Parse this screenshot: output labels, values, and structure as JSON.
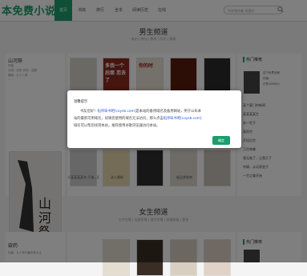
{
  "site": {
    "logo": "本免费小说"
  },
  "nav": {
    "items": [
      "首页",
      "书库",
      "排行",
      "全本",
      "阅读历史",
      "在线"
    ]
  },
  "search": {
    "placeholder": "书名和作者 关键字"
  },
  "male_section": {
    "title": "男生频道",
    "subtitle": "玄幻 | 修仙 | 都市 | 历史 | 悬疑"
  },
  "female_section": {
    "title": "女生频道",
    "subtitle": "古代言情 | 仙侠奇缘 | 现代言情 | 浪漫青春 | 更多"
  },
  "featured": {
    "name": "山河祭",
    "lines": [
      "作者",
      "分类：历史  状态：连载",
      "最新：九十八章"
    ],
    "desc": "……"
  },
  "books_top": [
    {
      "cover_title": "",
      "color": "#d7d2c8"
    },
    {
      "cover_title": "多我一个 后面 恋去了",
      "color": "#8a2a1e"
    },
    {
      "cover_title": "你的时",
      "color": "#e9e2d6"
    },
    {
      "cover_title": "",
      "color": "#5a1c0d"
    },
    {
      "cover_title": "",
      "color": "#2a2a2a"
    }
  ],
  "books_bottom": [
    {
      "caption": "上最顶级的宫殿法力无边",
      "color": "#cfcfcf"
    },
    {
      "caption": "逆天",
      "color": "#ead8b0"
    },
    {
      "caption": "",
      "color": "#2e2e2e"
    },
    {
      "caption": "",
      "color": "#dcd6cc"
    },
    {
      "caption": "",
      "color": "#c8c3b8"
    }
  ],
  "book_captions_bottom": [
    "十某某某某年 千道，旧有生...",
    "送人最新",
    "",
    "极品禁欲帝",
    ""
  ],
  "right_panel": {
    "title": "热门推荐",
    "info": [
      "这个世界全家",
      "作者：",
      "已有10000人"
    ],
    "items": [
      "某个豪门的新闻",
      "某某某某生",
      "末一世子",
      "真男世",
      "开挂后世",
      "万世帝尊",
      "我无敌了，让我天下",
      "夺嫡，从培养皇子",
      "一世之尊开始"
    ]
  },
  "female_right": {
    "title": "热门推荐"
  },
  "female_featured": {
    "name": "欲药",
    "line": "作者：九十年代都市夏大王"
  },
  "modal": {
    "title": "温馨提示",
    "line1_a": "书友您好！",
    "line1_link": "稻序味书吧[coysb.com]",
    "line1_b": "是本站的备用域名及备用网站，用于公布本",
    "line2": "站的最新可用域名，如果您使用的域名无法访问，那么点击",
    "line2_link": "稻序味书吧[coysb.com]",
    "line3": "域名可以帮您找到本站，推荐使用谷歌浏览器访问本站。",
    "ok": "确定"
  }
}
